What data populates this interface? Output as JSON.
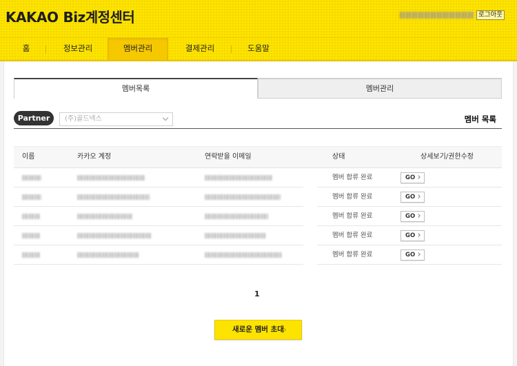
{
  "header": {
    "logo_main": "KAKAO",
    "logo_biz": "Biz계정센터",
    "logout_label": "로그아웃",
    "accent_color": "#fde300"
  },
  "nav": {
    "items": [
      {
        "label": "홈"
      },
      {
        "label": "정보관리"
      },
      {
        "label": "멤버관리",
        "active": true
      },
      {
        "label": "결제관리"
      },
      {
        "label": "도움말"
      }
    ]
  },
  "tabs": [
    {
      "label": "멤버목록",
      "active": true
    },
    {
      "label": "멤버관리"
    }
  ],
  "partner": {
    "badge": "Partner",
    "selected": "(주)골드넥스"
  },
  "section_title": "멤버 목록",
  "table": {
    "headers": [
      "이름",
      "카카오 계정",
      "연락받을 이메일",
      "상태",
      "상세보기/권한수정"
    ],
    "rows": [
      {
        "status": "멤버 합류 완료",
        "action": "GO"
      },
      {
        "status": "멤버 합류 완료",
        "action": "GO"
      },
      {
        "status": "멤버 합류 완료",
        "action": "GO"
      },
      {
        "status": "멤버 합류 완료",
        "action": "GO"
      },
      {
        "status": "멤버 합류 완료",
        "action": "GO"
      }
    ]
  },
  "pagination": {
    "current": "1"
  },
  "invite_button": "새로운 멤버 초대"
}
